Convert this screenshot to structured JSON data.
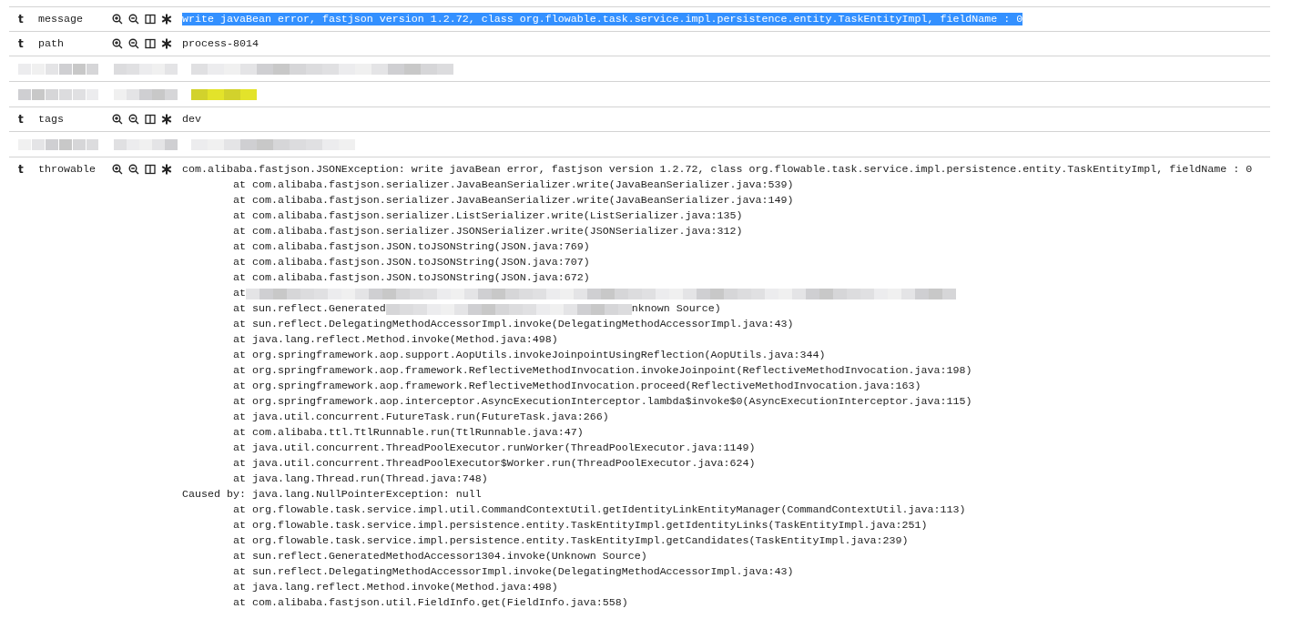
{
  "rows": [
    {
      "kind": "field",
      "type": "t",
      "name": "message",
      "value": "write javaBean error, fastjson version 1.2.72, class org.flowable.task.service.impl.persistence.entity.TaskEntityImpl, fieldName : 0",
      "selected": true
    },
    {
      "kind": "field",
      "type": "t",
      "name": "path",
      "value": "process-8014",
      "selected": false
    },
    {
      "kind": "redacted",
      "highlighted": false
    },
    {
      "kind": "redacted",
      "highlighted": true
    },
    {
      "kind": "field",
      "type": "t",
      "name": "tags",
      "value": "dev",
      "selected": false
    },
    {
      "kind": "redacted",
      "highlighted": false
    },
    {
      "kind": "trace",
      "type": "t",
      "name": "throwable",
      "lines": [
        {
          "kind": "text",
          "text": "com.alibaba.fastjson.JSONException: write javaBean error, fastjson version 1.2.72, class org.flowable.task.service.impl.persistence.entity.TaskEntityImpl, fieldName : 0"
        },
        {
          "kind": "text",
          "text": "\tat com.alibaba.fastjson.serializer.JavaBeanSerializer.write(JavaBeanSerializer.java:539)"
        },
        {
          "kind": "text",
          "text": "\tat com.alibaba.fastjson.serializer.JavaBeanSerializer.write(JavaBeanSerializer.java:149)"
        },
        {
          "kind": "text",
          "text": "\tat com.alibaba.fastjson.serializer.ListSerializer.write(ListSerializer.java:135)"
        },
        {
          "kind": "text",
          "text": "\tat com.alibaba.fastjson.serializer.JSONSerializer.write(JSONSerializer.java:312)"
        },
        {
          "kind": "text",
          "text": "\tat com.alibaba.fastjson.JSON.toJSONString(JSON.java:769)"
        },
        {
          "kind": "text",
          "text": "\tat com.alibaba.fastjson.JSON.toJSONString(JSON.java:707)"
        },
        {
          "kind": "text",
          "text": "\tat com.alibaba.fastjson.JSON.toJSONString(JSON.java:672)"
        },
        {
          "kind": "redacted",
          "text": "\tat"
        },
        {
          "kind": "redacted",
          "text": "\tat sun.reflect.Generated",
          "after": "nknown Source)"
        },
        {
          "kind": "text",
          "text": "\tat sun.reflect.DelegatingMethodAccessorImpl.invoke(DelegatingMethodAccessorImpl.java:43)"
        },
        {
          "kind": "text",
          "text": "\tat java.lang.reflect.Method.invoke(Method.java:498)"
        },
        {
          "kind": "text",
          "text": "\tat org.springframework.aop.support.AopUtils.invokeJoinpointUsingReflection(AopUtils.java:344)"
        },
        {
          "kind": "text",
          "text": "\tat org.springframework.aop.framework.ReflectiveMethodInvocation.invokeJoinpoint(ReflectiveMethodInvocation.java:198)"
        },
        {
          "kind": "text",
          "text": "\tat org.springframework.aop.framework.ReflectiveMethodInvocation.proceed(ReflectiveMethodInvocation.java:163)"
        },
        {
          "kind": "text",
          "text": "\tat org.springframework.aop.interceptor.AsyncExecutionInterceptor.lambda$invoke$0(AsyncExecutionInterceptor.java:115)"
        },
        {
          "kind": "text",
          "text": "\tat java.util.concurrent.FutureTask.run(FutureTask.java:266)"
        },
        {
          "kind": "text",
          "text": "\tat com.alibaba.ttl.TtlRunnable.run(TtlRunnable.java:47)"
        },
        {
          "kind": "text",
          "text": "\tat java.util.concurrent.ThreadPoolExecutor.runWorker(ThreadPoolExecutor.java:1149)"
        },
        {
          "kind": "text",
          "text": "\tat java.util.concurrent.ThreadPoolExecutor$Worker.run(ThreadPoolExecutor.java:624)"
        },
        {
          "kind": "text",
          "text": "\tat java.lang.Thread.run(Thread.java:748)"
        },
        {
          "kind": "text",
          "text": "Caused by: java.lang.NullPointerException: null"
        },
        {
          "kind": "text",
          "text": "\tat org.flowable.task.service.impl.util.CommandContextUtil.getIdentityLinkEntityManager(CommandContextUtil.java:113)"
        },
        {
          "kind": "text",
          "text": "\tat org.flowable.task.service.impl.persistence.entity.TaskEntityImpl.getIdentityLinks(TaskEntityImpl.java:251)"
        },
        {
          "kind": "text",
          "text": "\tat org.flowable.task.service.impl.persistence.entity.TaskEntityImpl.getCandidates(TaskEntityImpl.java:239)"
        },
        {
          "kind": "text",
          "text": "\tat sun.reflect.GeneratedMethodAccessor1304.invoke(Unknown Source)"
        },
        {
          "kind": "text",
          "text": "\tat sun.reflect.DelegatingMethodAccessorImpl.invoke(DelegatingMethodAccessorImpl.java:43)"
        },
        {
          "kind": "text",
          "text": "\tat java.lang.reflect.Method.invoke(Method.java:498)"
        },
        {
          "kind": "text",
          "text": "\tat com.alibaba.fastjson.util.FieldInfo.get(FieldInfo.java:558)"
        }
      ]
    }
  ]
}
